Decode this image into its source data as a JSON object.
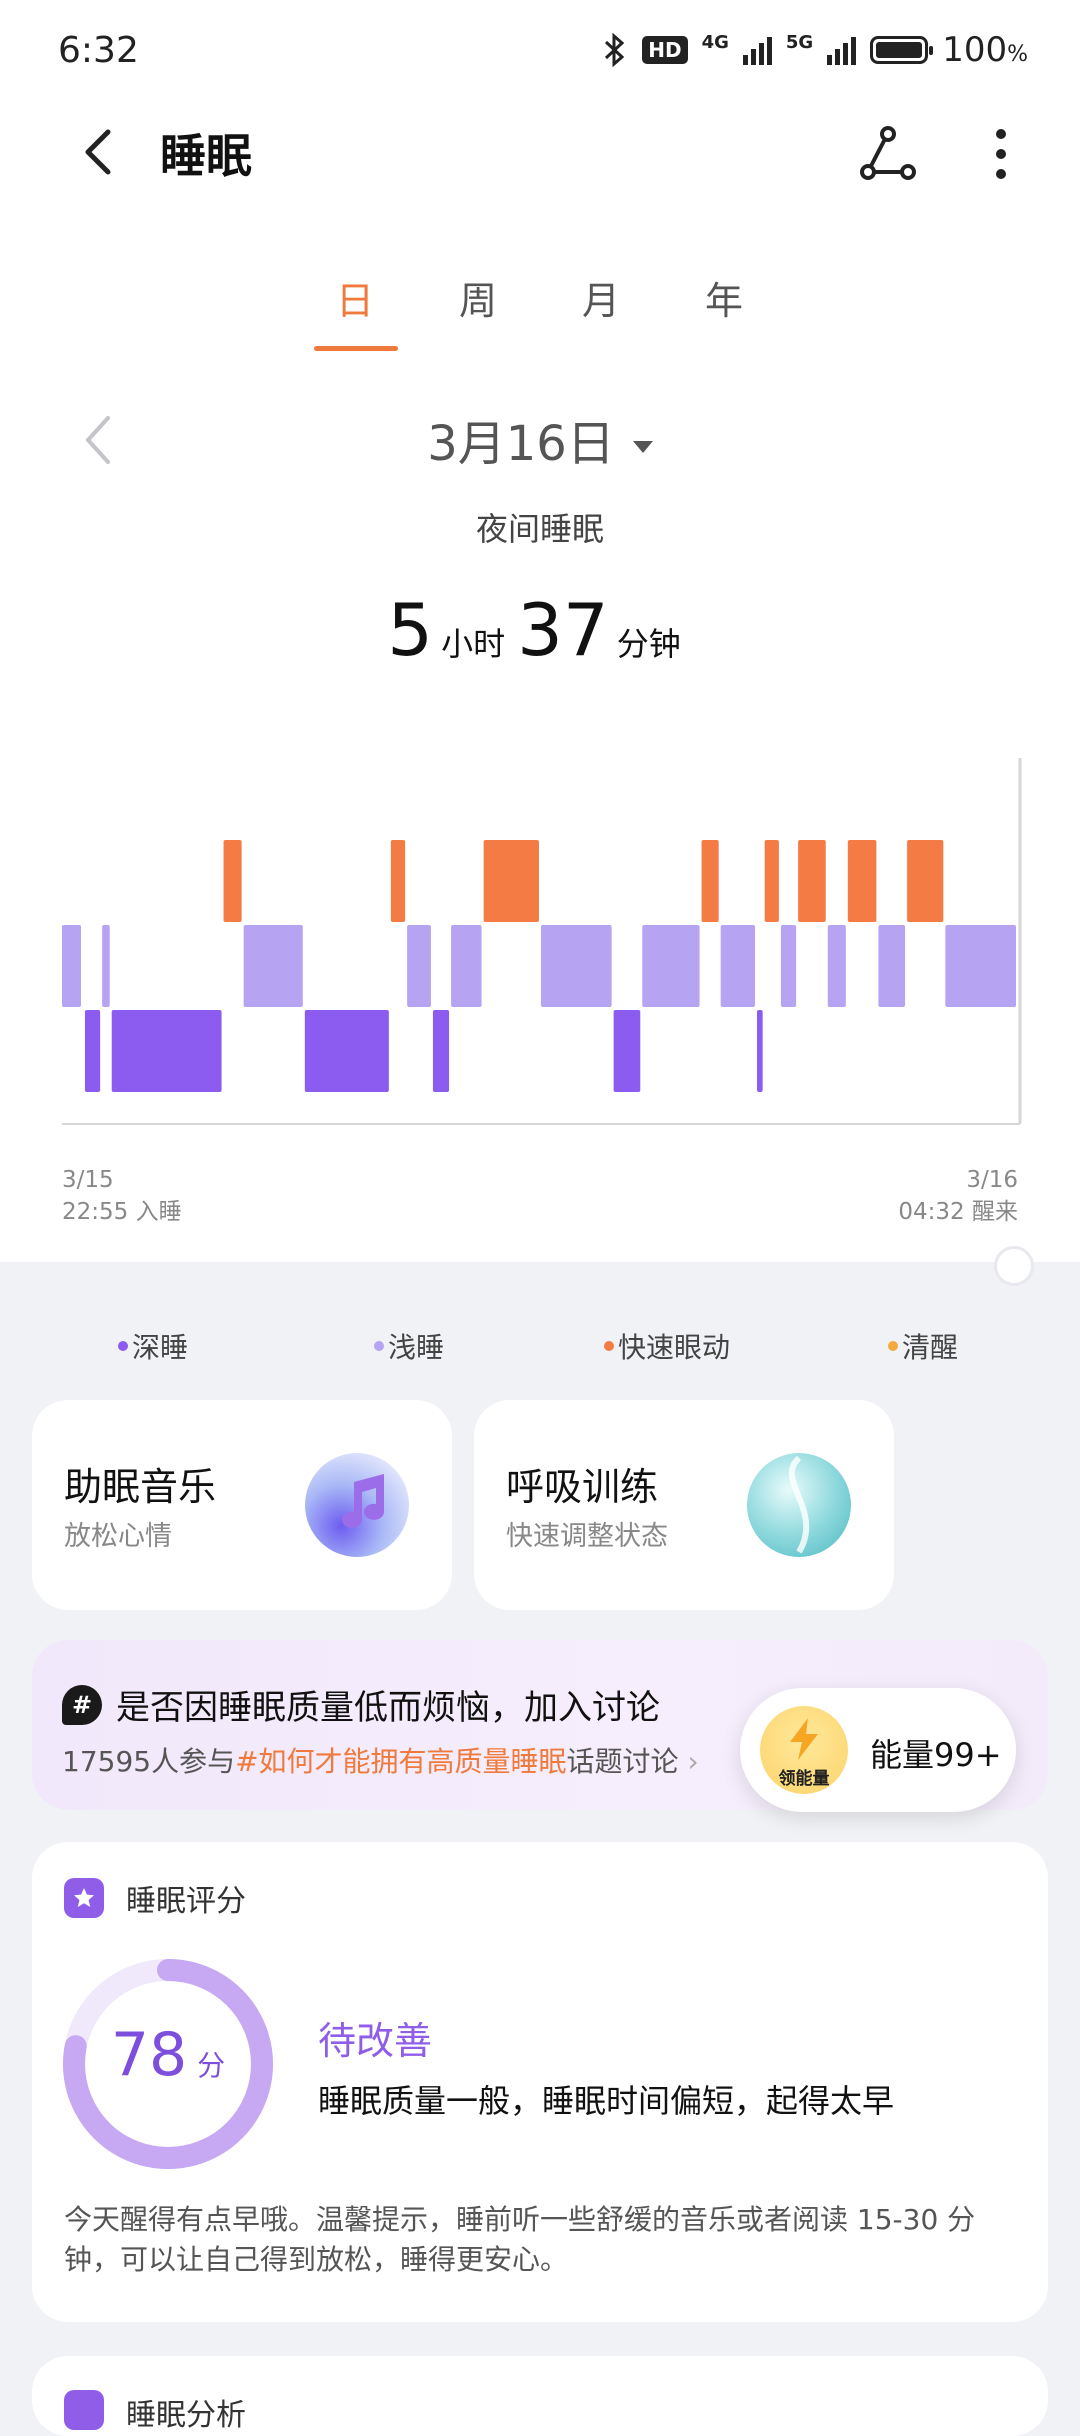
{
  "status_bar": {
    "time": "6:32",
    "network1": "4G",
    "network2": "5G",
    "hd": "HD",
    "battery": "100",
    "battery_unit": "%"
  },
  "header": {
    "title": "睡眠"
  },
  "tabs": [
    "日",
    "周",
    "月",
    "年"
  ],
  "date": {
    "label": "3月16日"
  },
  "summary": {
    "subtitle": "夜间睡眠",
    "hours": "5",
    "hours_unit": "小时",
    "minutes": "37",
    "minutes_unit": "分钟"
  },
  "chart_data": {
    "type": "bar",
    "stages": [
      "快速眼动",
      "浅睡",
      "深睡"
    ],
    "segments": [
      {
        "stage": "浅睡",
        "start": 0.0,
        "end": 2.2
      },
      {
        "stage": "深睡",
        "start": 2.4,
        "end": 4.2
      },
      {
        "stage": "浅睡",
        "start": 4.2,
        "end": 5.2
      },
      {
        "stage": "深睡",
        "start": 5.2,
        "end": 16.9
      },
      {
        "stage": "快速眼动",
        "start": 16.9,
        "end": 19.0
      },
      {
        "stage": "浅睡",
        "start": 19.0,
        "end": 25.4
      },
      {
        "stage": "深睡",
        "start": 25.4,
        "end": 34.4
      },
      {
        "stage": "快速眼动",
        "start": 34.4,
        "end": 36.1
      },
      {
        "stage": "浅睡",
        "start": 36.1,
        "end": 38.8
      },
      {
        "stage": "深睡",
        "start": 38.8,
        "end": 40.7
      },
      {
        "stage": "浅睡",
        "start": 40.7,
        "end": 44.1
      },
      {
        "stage": "快速眼动",
        "start": 44.1,
        "end": 50.1
      },
      {
        "stage": "浅睡",
        "start": 50.1,
        "end": 57.7
      },
      {
        "stage": "深睡",
        "start": 57.7,
        "end": 60.7
      },
      {
        "stage": "浅睡",
        "start": 60.7,
        "end": 66.9
      },
      {
        "stage": "快速眼动",
        "start": 66.9,
        "end": 68.9
      },
      {
        "stage": "浅睡",
        "start": 68.9,
        "end": 72.7
      },
      {
        "stage": "深睡",
        "start": 72.7,
        "end": 73.5
      },
      {
        "stage": "快速眼动",
        "start": 73.5,
        "end": 75.2
      },
      {
        "stage": "浅睡",
        "start": 75.2,
        "end": 77.0
      },
      {
        "stage": "快速眼动",
        "start": 77.0,
        "end": 80.1
      },
      {
        "stage": "浅睡",
        "start": 80.1,
        "end": 82.2
      },
      {
        "stage": "快速眼动",
        "start": 82.2,
        "end": 85.4
      },
      {
        "stage": "浅睡",
        "start": 85.4,
        "end": 88.4
      },
      {
        "stage": "快速眼动",
        "start": 88.4,
        "end": 92.4
      },
      {
        "stage": "浅睡",
        "start": 92.4,
        "end": 100.0
      }
    ],
    "x_start": {
      "date": "3/15",
      "time": "22:55",
      "label": "入睡"
    },
    "x_end": {
      "date": "3/16",
      "time": "04:32",
      "label": "醒来"
    },
    "colors": {
      "deep": "#8c5cf0",
      "light": "#b6a3f2",
      "rem": "#f47b44"
    }
  },
  "legend": [
    {
      "label": "深睡",
      "color": "#8c5cf0"
    },
    {
      "label": "浅睡",
      "color": "#b6a3f2"
    },
    {
      "label": "快速眼动",
      "color": "#f47b44"
    },
    {
      "label": "清醒",
      "color": "#f4a93b"
    }
  ],
  "cards": {
    "music": {
      "title": "助眠音乐",
      "subtitle": "放松心情"
    },
    "breath": {
      "title": "呼吸训练",
      "subtitle": "快速调整状态"
    }
  },
  "banner": {
    "title": "是否因睡眠质量低而烦恼，加入讨论",
    "count_prefix": "17595人参与",
    "topic": "#如何才能拥有高质量睡眠",
    "suffix": "话题讨论",
    "energy_badge": "领能量",
    "energy_text": "能量99+"
  },
  "score": {
    "section_title": "睡眠评分",
    "value": "78",
    "unit": "分",
    "value_num": 78,
    "level": "待改善",
    "description": "睡眠质量一般，睡眠时间偏短，起得太早",
    "tip": "今天醒得有点早哦。温馨提示，睡前听一些舒缓的音乐或者阅读 15-30 分钟，可以让自己得到放松，睡得更安心。"
  },
  "next_section": {
    "title": "睡眠分析"
  }
}
